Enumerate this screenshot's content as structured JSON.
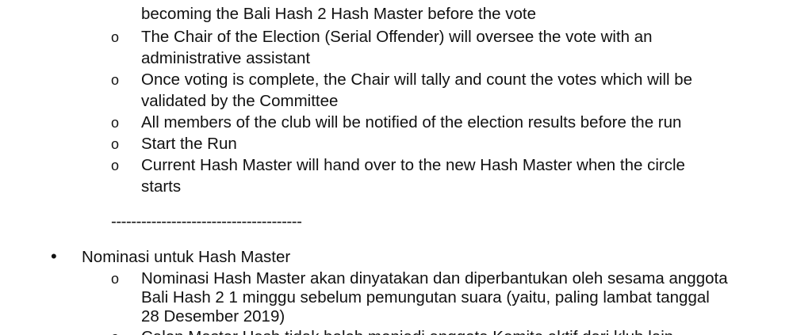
{
  "document": {
    "sub_bullet_glyph": "o",
    "top_bullet_glyph": "•",
    "section1": {
      "items": [
        {
          "lines": [
            "becoming the Bali Hash 2 Hash Master before the vote"
          ]
        },
        {
          "lines": [
            "The Chair of the Election (Serial Offender) will oversee the vote with an",
            "administrative assistant"
          ]
        },
        {
          "lines": [
            "Once voting is complete, the Chair will tally and count the votes which will be",
            "validated by the Committee"
          ]
        },
        {
          "lines": [
            "All members of the club will be notified of the election results before the run"
          ]
        },
        {
          "lines": [
            "Start the Run"
          ]
        },
        {
          "lines": [
            "Current Hash Master will hand over to the new Hash Master when the circle",
            "starts"
          ]
        }
      ]
    },
    "divider": "--------------------------------------",
    "section2": {
      "heading": "Nominasi untuk Hash Master",
      "items": [
        {
          "lines": [
            "Nominasi Hash Master akan dinyatakan dan diperbantukan oleh sesama anggota",
            "Bali Hash 2 1 minggu sebelum pemungutan suara (yaitu, paling lambat tanggal",
            "28 Desember 2019)"
          ]
        },
        {
          "lines": [
            "Calon Master Hash tidak boleh menjadi anggota Komite aktif dari klub lain"
          ]
        }
      ]
    }
  }
}
